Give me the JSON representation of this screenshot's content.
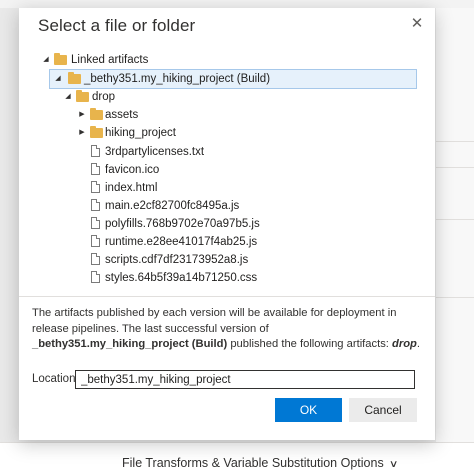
{
  "dialog": {
    "title": "Select a file or folder",
    "close_icon": "close-icon",
    "ok_label": "OK",
    "cancel_label": "Cancel"
  },
  "tree": {
    "root": "Linked artifacts",
    "build": "_bethy351.my_hiking_project (Build)",
    "drop": "drop",
    "folders": [
      "assets",
      "hiking_project"
    ],
    "files": [
      "3rdpartylicenses.txt",
      "favicon.ico",
      "index.html",
      "main.e2cf82700fc8495a.js",
      "polyfills.768b9702e70a97b5.js",
      "runtime.e28ee41017f4ab25.js",
      "scripts.cdf7df23173952a8.js",
      "styles.64b5f39a14b71250.css"
    ]
  },
  "description": {
    "part1": "The artifacts published by each version will be available for deployment in release pipelines. The last successful version of ",
    "build_name": "_bethy351.my_hiking_project (Build)",
    "part2": " published the following artifacts: ",
    "artifact": "drop",
    "part3": "."
  },
  "location": {
    "label": "Location",
    "value": "_bethy351.my_hiking_project"
  },
  "background": {
    "bottom_label": "File Transforms & Variable Substitution Options",
    "bottom_chevron": "chevron-down-icon"
  },
  "colors": {
    "primary": "#0078d4",
    "folder": "#e8b44c",
    "selection": "#e6f1fb"
  }
}
